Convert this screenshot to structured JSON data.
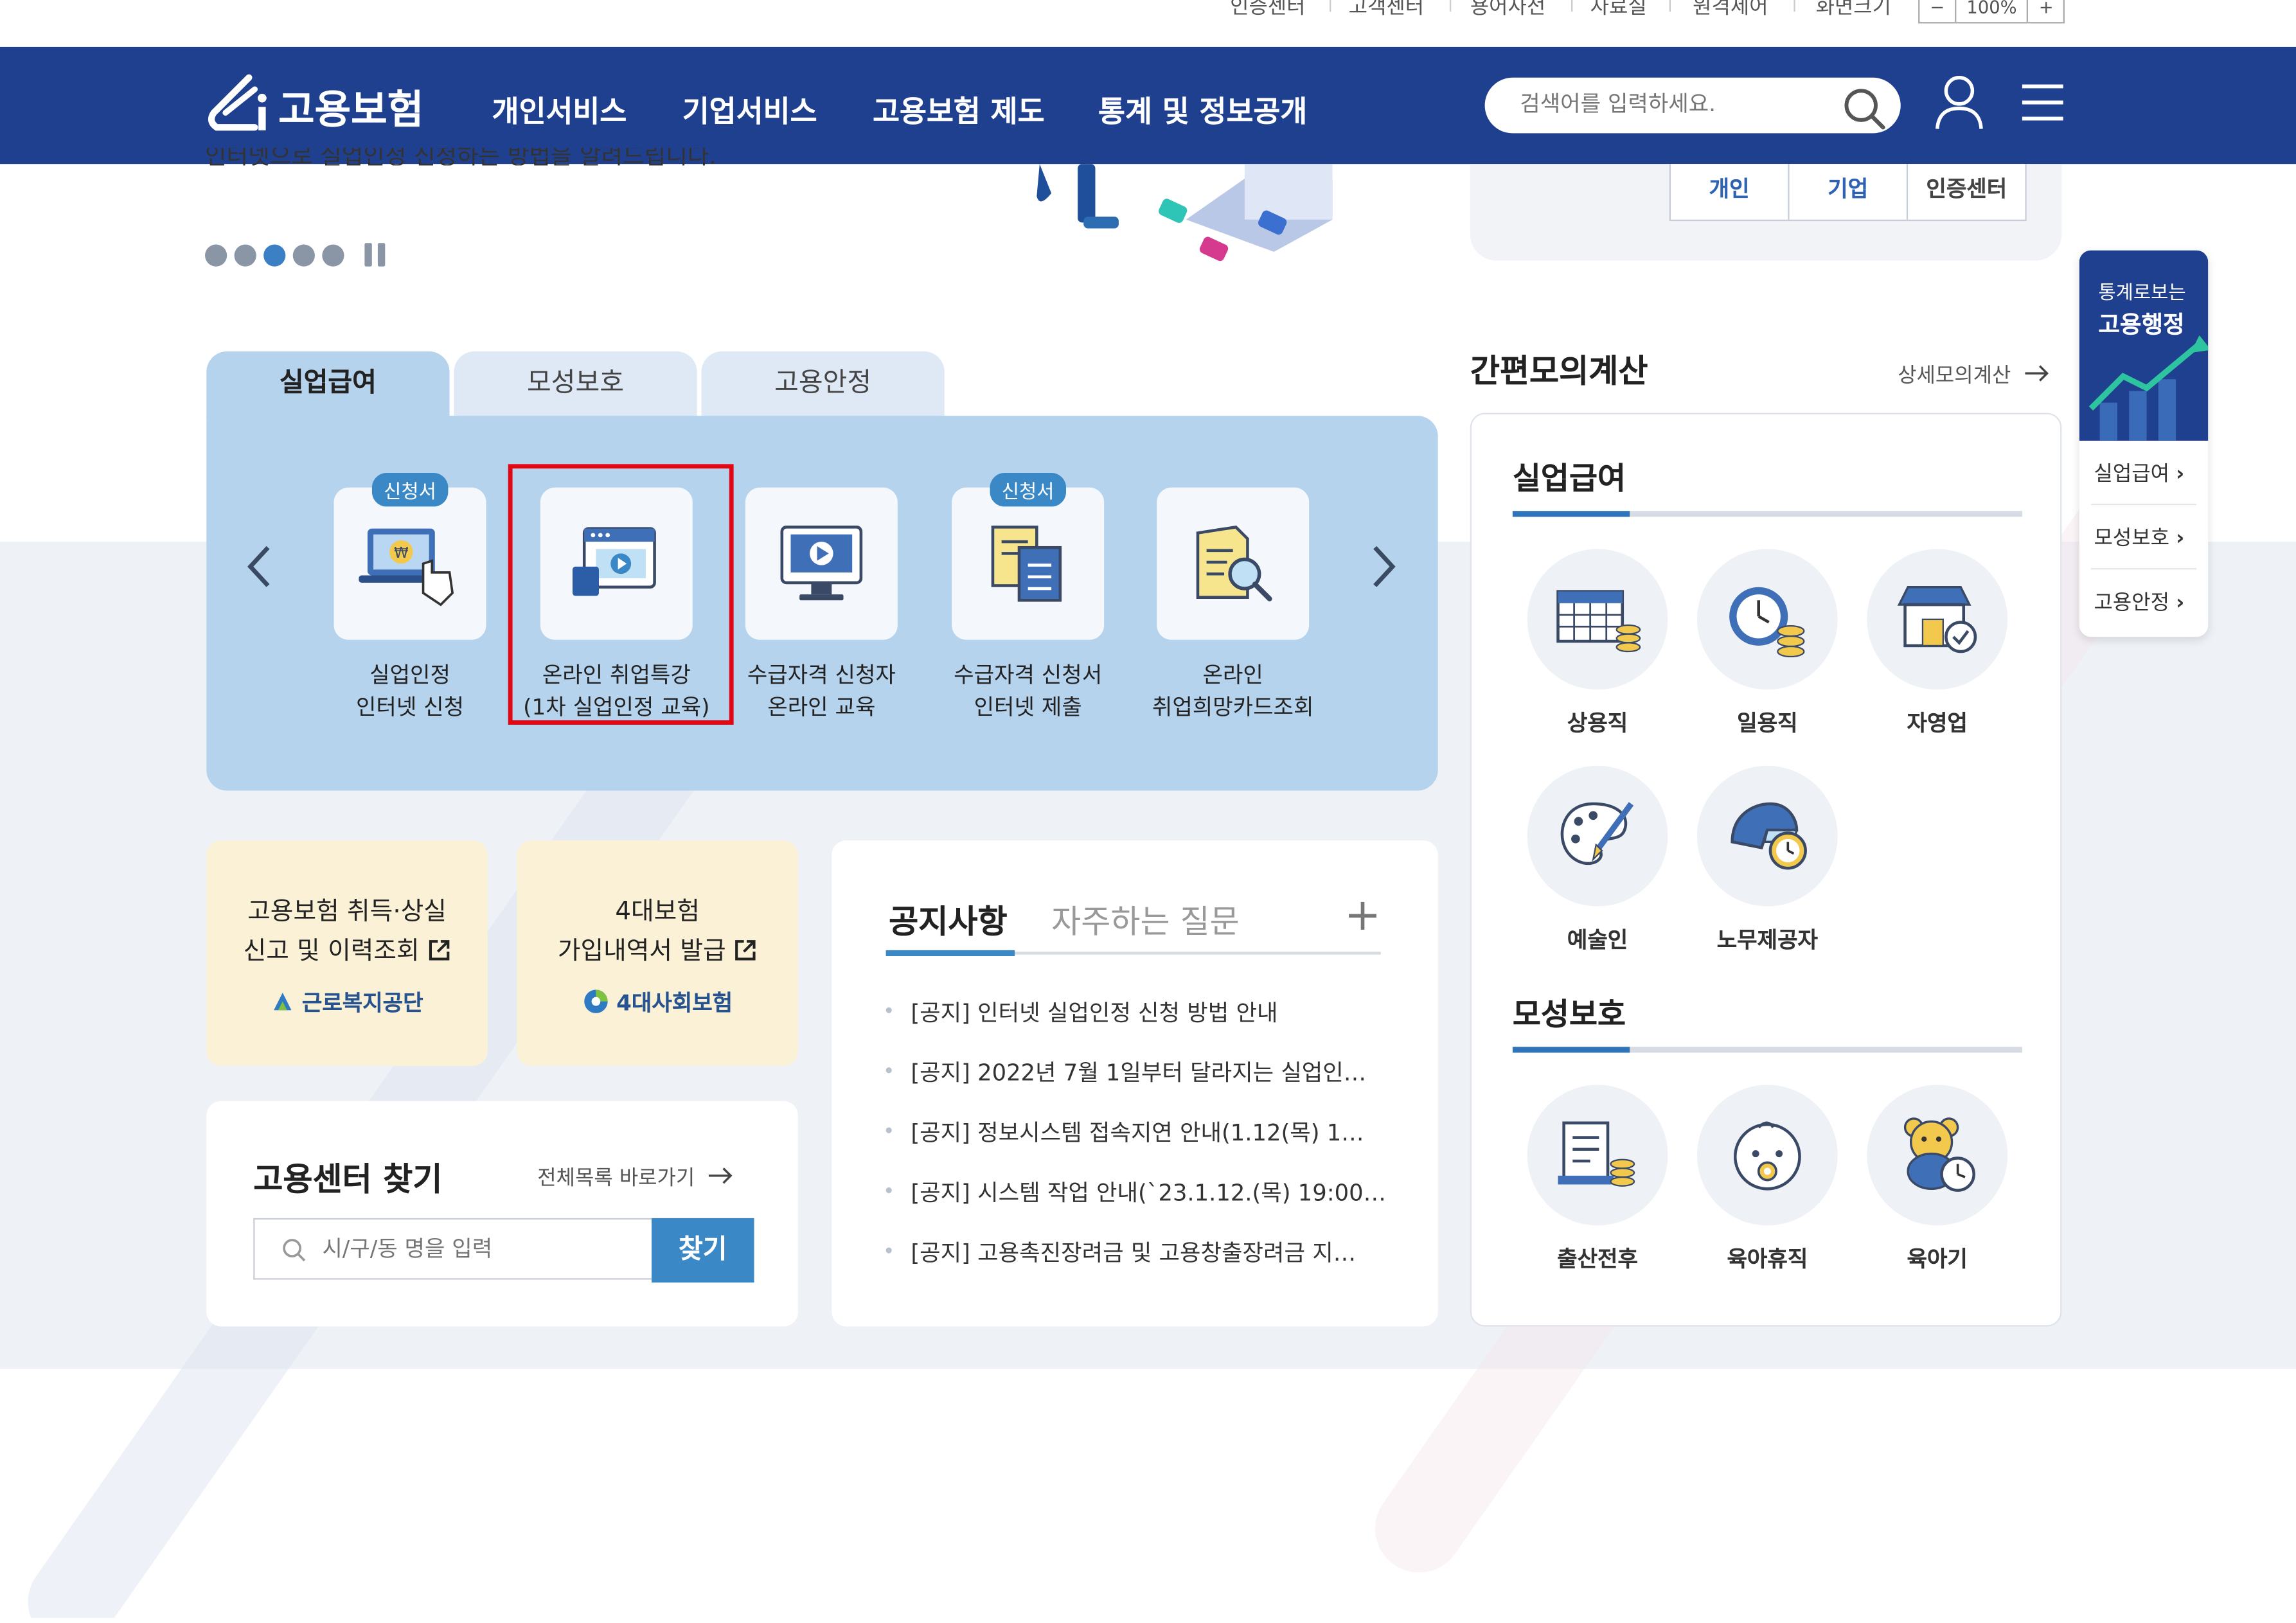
{
  "util_nav": [
    "인증센터",
    "고객센터",
    "용어사전",
    "자료실",
    "원격제어",
    "화면크기"
  ],
  "zoom": {
    "minus": "−",
    "value": "100%",
    "plus": "+"
  },
  "header": {
    "logo": "고용보험",
    "menu": [
      "개인서비스",
      "기업서비스",
      "고용보험 제도",
      "통계 및 정보공개"
    ],
    "search_placeholder": "검색어를 입력하세요."
  },
  "hero": {
    "text": "인터넷으로 실업인정 신청하는 방법을 알려드립니다.",
    "slide_count": 5,
    "active_slide": 3
  },
  "login_tabs": [
    "개인",
    "기업",
    "인증센터"
  ],
  "service_tabs": [
    "실업급여",
    "모성보호",
    "고용안정"
  ],
  "services": [
    {
      "badge": "신청서",
      "line1": "실업인정",
      "line2": "인터넷 신청"
    },
    {
      "badge": "",
      "line1": "온라인 취업특강",
      "line2": "(1차 실업인정 교육)"
    },
    {
      "badge": "",
      "line1": "수급자격 신청자",
      "line2": "온라인 교육"
    },
    {
      "badge": "신청서",
      "line1": "수급자격 신청서",
      "line2": "인터넷 제출"
    },
    {
      "badge": "",
      "line1": "온라인",
      "line2": "취업희망카드조회"
    }
  ],
  "ext_cards": [
    {
      "line1": "고용보험 취득·상실",
      "line2": "신고 및 이력조회",
      "brand": "근로복지공단"
    },
    {
      "line1": "4대보험",
      "line2": "가입내역서 발급",
      "brand": "4대사회보험"
    }
  ],
  "center_find": {
    "title": "고용센터 찾기",
    "link": "전체목록 바로가기",
    "placeholder": "시/구/동 명을 입력",
    "button": "찾기"
  },
  "notice": {
    "tabs": [
      "공지사항",
      "자주하는 질문"
    ],
    "more": "+",
    "items": [
      "[공지] 인터넷 실업인정 신청 방법 안내",
      "[공지] 2022년 7월 1일부터 달라지는 실업인…",
      "[공지] 정보시스템 접속지연 안내(1.12(목) 1…",
      "[공지] 시스템 작업 안내(`23.1.12.(목) 19:00 …",
      "[공지] 고용촉진장려금 및 고용창출장려금 지…"
    ]
  },
  "calc": {
    "title": "간편모의계산",
    "link": "상세모의계산",
    "sections": [
      {
        "name": "실업급여",
        "items": [
          "상용직",
          "일용직",
          "자영업",
          "예술인",
          "노무제공자"
        ]
      },
      {
        "name": "모성보호",
        "items": [
          "출산전후",
          "육아휴직",
          "육아기"
        ]
      }
    ]
  },
  "side_widget": {
    "line1": "통계로보는",
    "line2": "고용행정",
    "links": [
      "실업급여",
      "모성보호",
      "고용안정"
    ]
  },
  "colors": {
    "navy": "#1f3f8f",
    "accent": "#3a88c6",
    "panel": "#b6d3ee",
    "highlight": "#e30613"
  }
}
